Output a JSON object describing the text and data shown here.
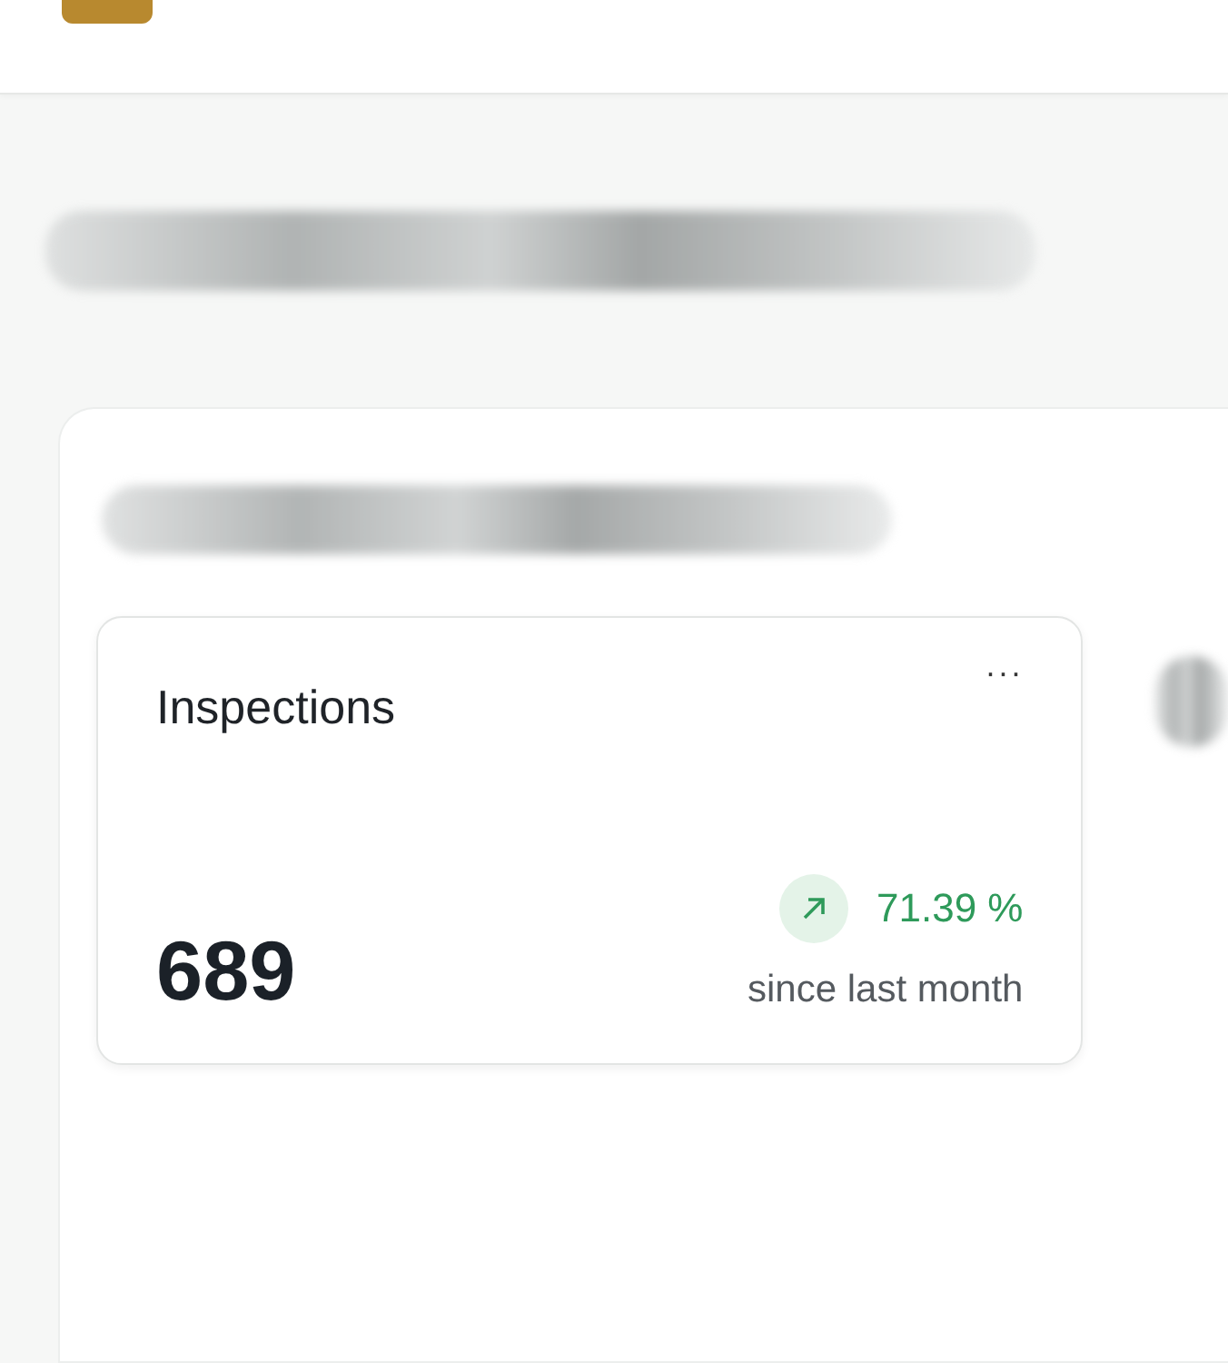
{
  "stat_card": {
    "title": "Inspections",
    "menu": "···",
    "value": "689",
    "trend": {
      "rising": true,
      "change": "71.39 %",
      "caption": "since last month"
    }
  }
}
